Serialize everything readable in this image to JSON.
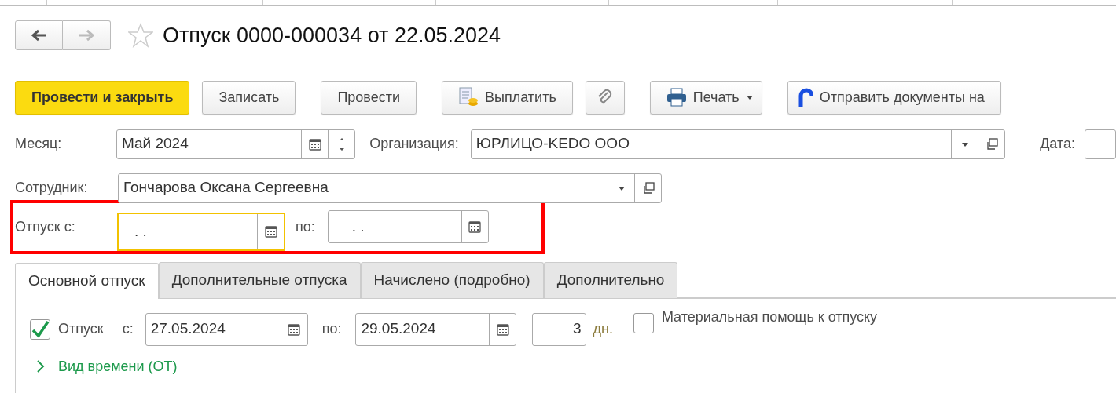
{
  "nav": {
    "back": {
      "disabled": false
    },
    "forward": {
      "disabled": true
    }
  },
  "favorite": {
    "on": false
  },
  "title": "Отпуск 0000-000034 от 22.05.2024",
  "toolbar": [
    {
      "kind": "primary",
      "label": "Провести и закрыть"
    },
    {
      "kind": "plain",
      "label": "Записать"
    },
    {
      "kind": "plain",
      "label": "Провести"
    },
    {
      "kind": "pay",
      "label": "Выплатить"
    },
    {
      "kind": "attach"
    },
    {
      "kind": "print",
      "label": "Печать"
    },
    {
      "kind": "send",
      "label": "Отправить документы на"
    }
  ],
  "month": {
    "label": "Месяц:",
    "value": "Май 2024"
  },
  "organization": {
    "label": "Организация:",
    "value": "ЮРЛИЦО-KEDO ООО"
  },
  "date": {
    "label": "Дата:"
  },
  "employee": {
    "label": "Сотрудник:",
    "value": "Гончарова Оксана Сергеевна"
  },
  "vacation_period": {
    "highlighted": true,
    "from_label": "Отпуск с:",
    "from_value": ". .",
    "from_focused": true,
    "to_label": "по:",
    "to_value": ". ."
  },
  "tabs": [
    {
      "label": "Основной отпуск",
      "selected": true
    },
    {
      "label": "Дополнительные отпуска",
      "selected": false
    },
    {
      "label": "Начислено (подробно)",
      "selected": false
    },
    {
      "label": "Дополнительно",
      "selected": false
    }
  ],
  "main_vacation": {
    "checkbox": {
      "label": "Отпуск",
      "checked": true
    },
    "from_label": "с:",
    "from_value": "27.05.2024",
    "to_label": "по:",
    "to_value": "29.05.2024",
    "days": "3",
    "days_unit": "дн.",
    "material_help": {
      "label": "Материальная помощь к отпуску",
      "checked": false
    },
    "time_kind": {
      "label": "Вид времени (ОТ)",
      "expanded": false
    }
  }
}
